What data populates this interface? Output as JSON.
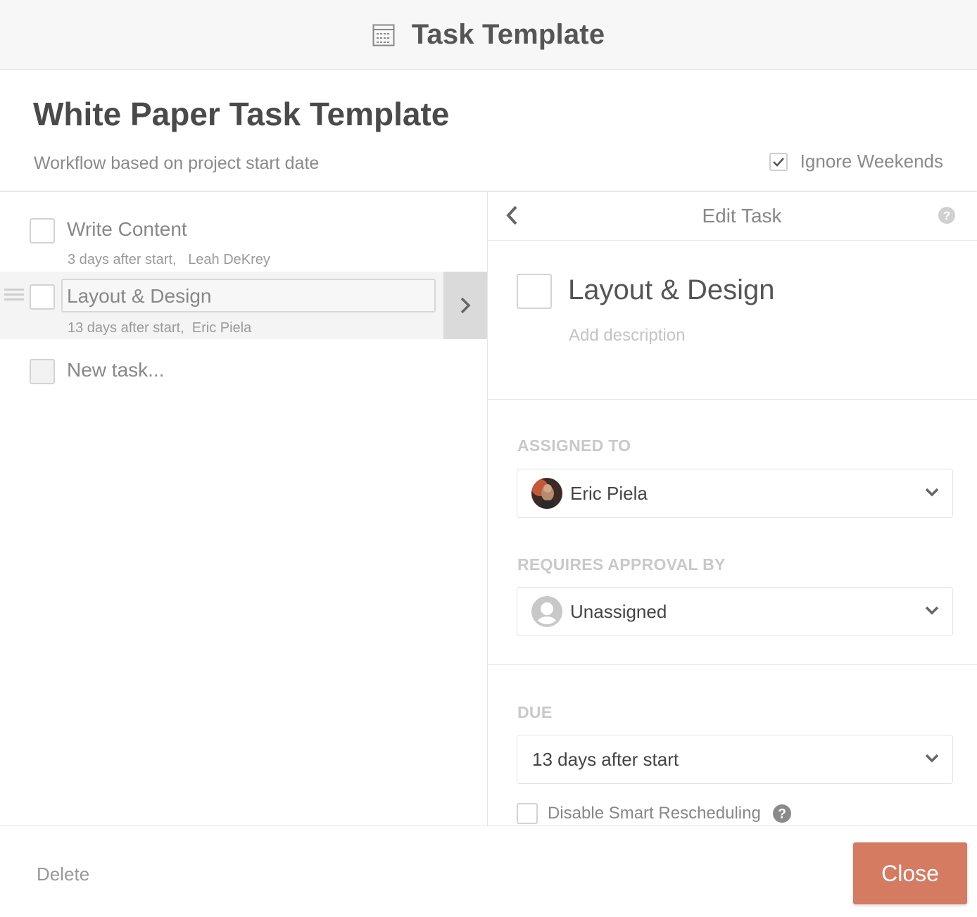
{
  "topbar": {
    "title": "Task Template",
    "icon": "template-icon"
  },
  "header": {
    "title": "White Paper Task Template",
    "subtitle": "Workflow based on project start date",
    "ignore_weekends": {
      "label": "Ignore Weekends",
      "checked": true
    }
  },
  "tasks": [
    {
      "name": "Write Content",
      "due": "3 days after start,",
      "assignee": "Leah DeKrey",
      "selected": false
    },
    {
      "name": "Layout & Design",
      "due": "13 days after start,",
      "assignee": "Eric Piela",
      "selected": true
    }
  ],
  "new_task": {
    "placeholder": "New task..."
  },
  "edit_panel": {
    "title": "Edit Task",
    "task_name": "Layout & Design",
    "description_placeholder": "Add description",
    "assigned_to": {
      "label": "ASSIGNED TO",
      "value": "Eric Piela"
    },
    "requires_approval": {
      "label": "REQUIRES APPROVAL BY",
      "value": "Unassigned"
    },
    "due": {
      "label": "DUE",
      "value": "13 days after start"
    },
    "smart_rescheduling": {
      "label": "Disable Smart Rescheduling",
      "checked": false
    }
  },
  "footer": {
    "delete_label": "Delete",
    "close_label": "Close"
  },
  "colors": {
    "close_button": "#d57b62",
    "background": "#ffffff",
    "topbar": "#f7f7f7"
  }
}
